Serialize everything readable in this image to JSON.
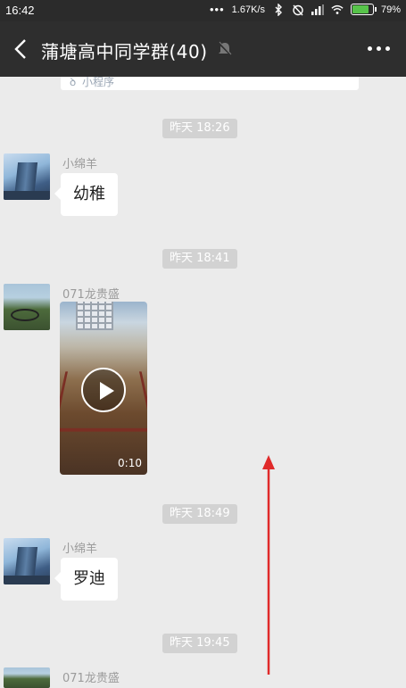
{
  "status_bar": {
    "time": "16:42",
    "speed": "1.67K/s",
    "battery_percent": "79%"
  },
  "header": {
    "back_icon": "chevron-left-icon",
    "title": "蒲塘高中同学群(40)",
    "mute_icon": "bell-off-icon",
    "more_icon": "more-dots-icon"
  },
  "mini_program_card": {
    "label": "小程序"
  },
  "messages": [
    {
      "type": "time",
      "text": "昨天 18:26"
    },
    {
      "type": "text",
      "sender": "小绵羊",
      "text": "幼稚"
    },
    {
      "type": "time",
      "text": "昨天 18:41"
    },
    {
      "type": "video",
      "sender": "071龙贵盛",
      "duration": "0:10"
    },
    {
      "type": "time",
      "text": "昨天 18:49"
    },
    {
      "type": "text",
      "sender": "小绵羊",
      "text": "罗迪"
    },
    {
      "type": "time",
      "text": "昨天 19:45"
    },
    {
      "type": "partial",
      "sender": "071龙贵盛"
    }
  ],
  "annotation": {
    "arrow_color": "#e02a2a",
    "direction": "up"
  }
}
